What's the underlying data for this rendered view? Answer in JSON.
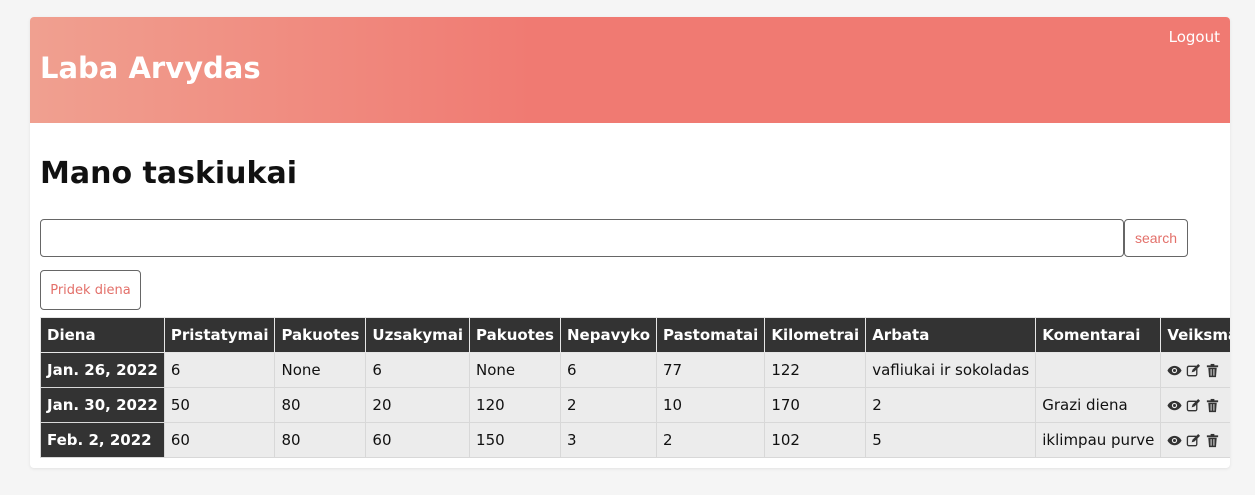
{
  "header": {
    "greeting": "Laba Arvydas",
    "logout_label": "Logout"
  },
  "main": {
    "title": "Mano taskiukai",
    "search": {
      "value": "",
      "placeholder": "",
      "button_label": "search"
    },
    "add_button_label": "Pridek diena"
  },
  "table": {
    "columns": [
      "Diena",
      "Pristatymai",
      "Pakuotes",
      "Uzsakymai",
      "Pakuotes",
      "Nepavyko",
      "Pastomatai",
      "Kilometrai",
      "Arbata",
      "Komentarai",
      "Veiksmai"
    ],
    "rows": [
      {
        "date": "Jan. 26, 2022",
        "cells": [
          "6",
          "None",
          "6",
          "None",
          "6",
          "77",
          "122",
          "vafliukai ir sokoladas",
          ""
        ]
      },
      {
        "date": "Jan. 30, 2022",
        "cells": [
          "50",
          "80",
          "20",
          "120",
          "2",
          "10",
          "170",
          "2",
          "Grazi diena"
        ]
      },
      {
        "date": "Feb. 2, 2022",
        "cells": [
          "60",
          "80",
          "60",
          "150",
          "3",
          "2",
          "102",
          "5",
          "iklimpau purve"
        ]
      }
    ],
    "row_actions": [
      "eye-icon",
      "edit-icon",
      "trash-icon"
    ]
  },
  "colors": {
    "accent": "#e3706a",
    "header_gradient_start": "#f0a090",
    "header_gradient_end": "#f07a72",
    "table_header_bg": "#333333"
  }
}
